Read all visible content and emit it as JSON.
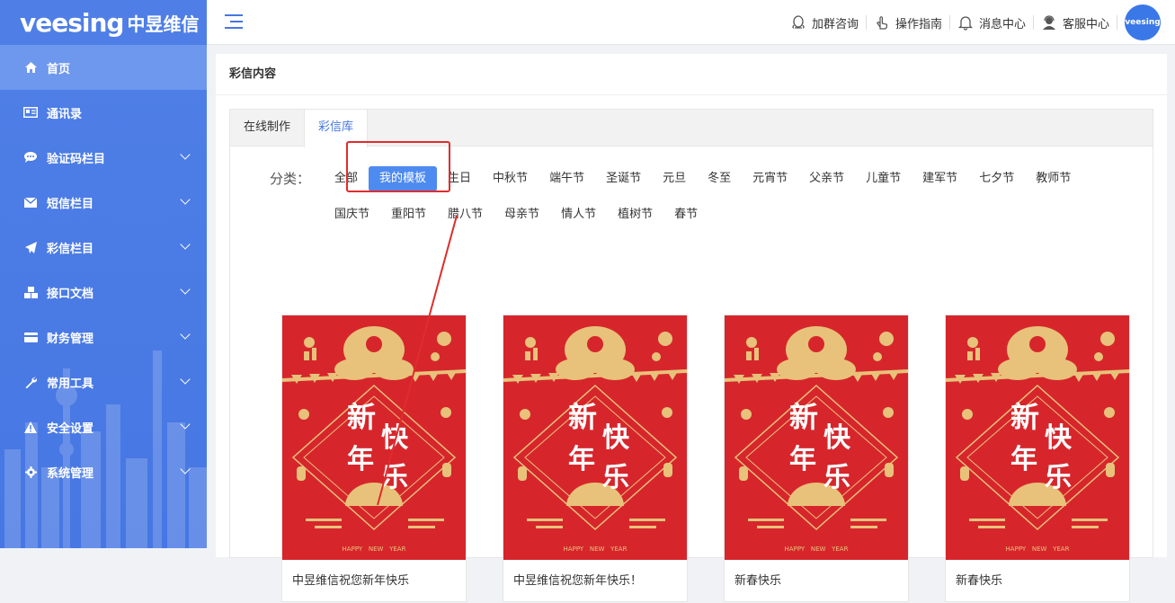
{
  "brand": {
    "logo_en": "veesing",
    "logo_cn": "中昱维信"
  },
  "sidebar": {
    "items": [
      {
        "label": "首页",
        "icon": "home-icon",
        "active": true,
        "expand": false
      },
      {
        "label": "通讯录",
        "icon": "address-book-icon",
        "active": false,
        "expand": false
      },
      {
        "label": "验证码栏目",
        "icon": "chat-bubble-icon",
        "active": false,
        "expand": true
      },
      {
        "label": "短信栏目",
        "icon": "envelope-icon",
        "active": false,
        "expand": true
      },
      {
        "label": "彩信栏目",
        "icon": "paper-plane-icon",
        "active": false,
        "expand": true
      },
      {
        "label": "接口文档",
        "icon": "cubes-icon",
        "active": false,
        "expand": true
      },
      {
        "label": "财务管理",
        "icon": "credit-card-icon",
        "active": false,
        "expand": true
      },
      {
        "label": "常用工具",
        "icon": "wrench-icon",
        "active": false,
        "expand": true
      },
      {
        "label": "安全设置",
        "icon": "warning-icon",
        "active": false,
        "expand": true
      },
      {
        "label": "系统管理",
        "icon": "gear-icon",
        "active": false,
        "expand": true
      }
    ]
  },
  "header": {
    "nav": [
      {
        "label": "加群咨询",
        "icon": "qq-icon"
      },
      {
        "label": "操作指南",
        "icon": "hand-pointer-icon"
      },
      {
        "label": "消息中心",
        "icon": "bell-icon"
      },
      {
        "label": "客服中心",
        "icon": "support-agent-icon"
      }
    ],
    "avatar_text": "veesing"
  },
  "page": {
    "title": "彩信内容"
  },
  "tabs": [
    {
      "label": "在线制作",
      "active": false
    },
    {
      "label": "彩信库",
      "active": true
    }
  ],
  "categories": {
    "label": "分类：",
    "row1": [
      "全部",
      "我的模板",
      "生日",
      "中秋节",
      "端午节",
      "圣诞节",
      "元旦",
      "冬至",
      "元宵节",
      "父亲节",
      "儿童节",
      "建军节",
      "七夕节",
      "教师节"
    ],
    "row2": [
      "国庆节",
      "重阳节",
      "腊八节",
      "母亲节",
      "情人节",
      "植树节",
      "春节"
    ],
    "selected": "我的模板"
  },
  "cards": [
    {
      "caption": "中昱维信祝您新年快乐",
      "art_text_1": "新",
      "art_text_2": "快",
      "art_text_3": "年",
      "art_text_4": "乐",
      "footer": "HAPPY   NEW   YEAR"
    },
    {
      "caption": "中昱维信祝您新年快乐！",
      "art_text_1": "新",
      "art_text_2": "快",
      "art_text_3": "年",
      "art_text_4": "乐",
      "footer": "HAPPY   NEW   YEAR"
    },
    {
      "caption": "新春快乐",
      "art_text_1": "新",
      "art_text_2": "快",
      "art_text_3": "年",
      "art_text_4": "乐",
      "footer": "HAPPY   NEW   YEAR"
    },
    {
      "caption": "新春快乐",
      "art_text_1": "新",
      "art_text_2": "快",
      "art_text_3": "年",
      "art_text_4": "乐",
      "footer": "HAPPY   NEW   YEAR"
    }
  ],
  "colors": {
    "accent": "#4677e3",
    "card_red": "#d6262c",
    "gold": "#e8c27a",
    "annotation": "#e02c2c"
  }
}
